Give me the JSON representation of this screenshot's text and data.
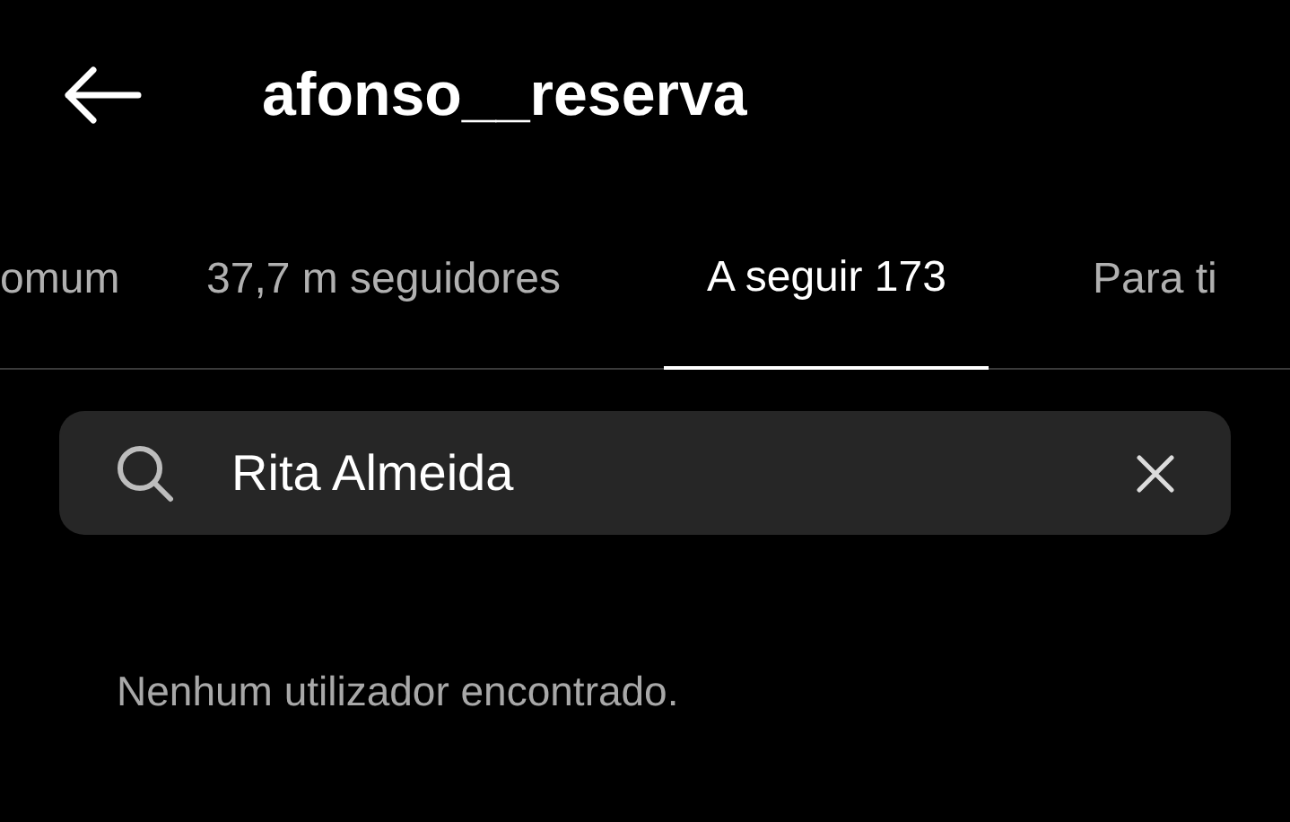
{
  "header": {
    "title": "afonso__reserva"
  },
  "tabs": [
    {
      "label": "omum",
      "selected": false
    },
    {
      "label": "37,7 m seguidores",
      "selected": false
    },
    {
      "label": "A seguir 173",
      "selected": true
    },
    {
      "label": "Para ti",
      "selected": false
    }
  ],
  "search": {
    "value": "Rita Almeida"
  },
  "message": "Nenhum utilizador encontrado."
}
